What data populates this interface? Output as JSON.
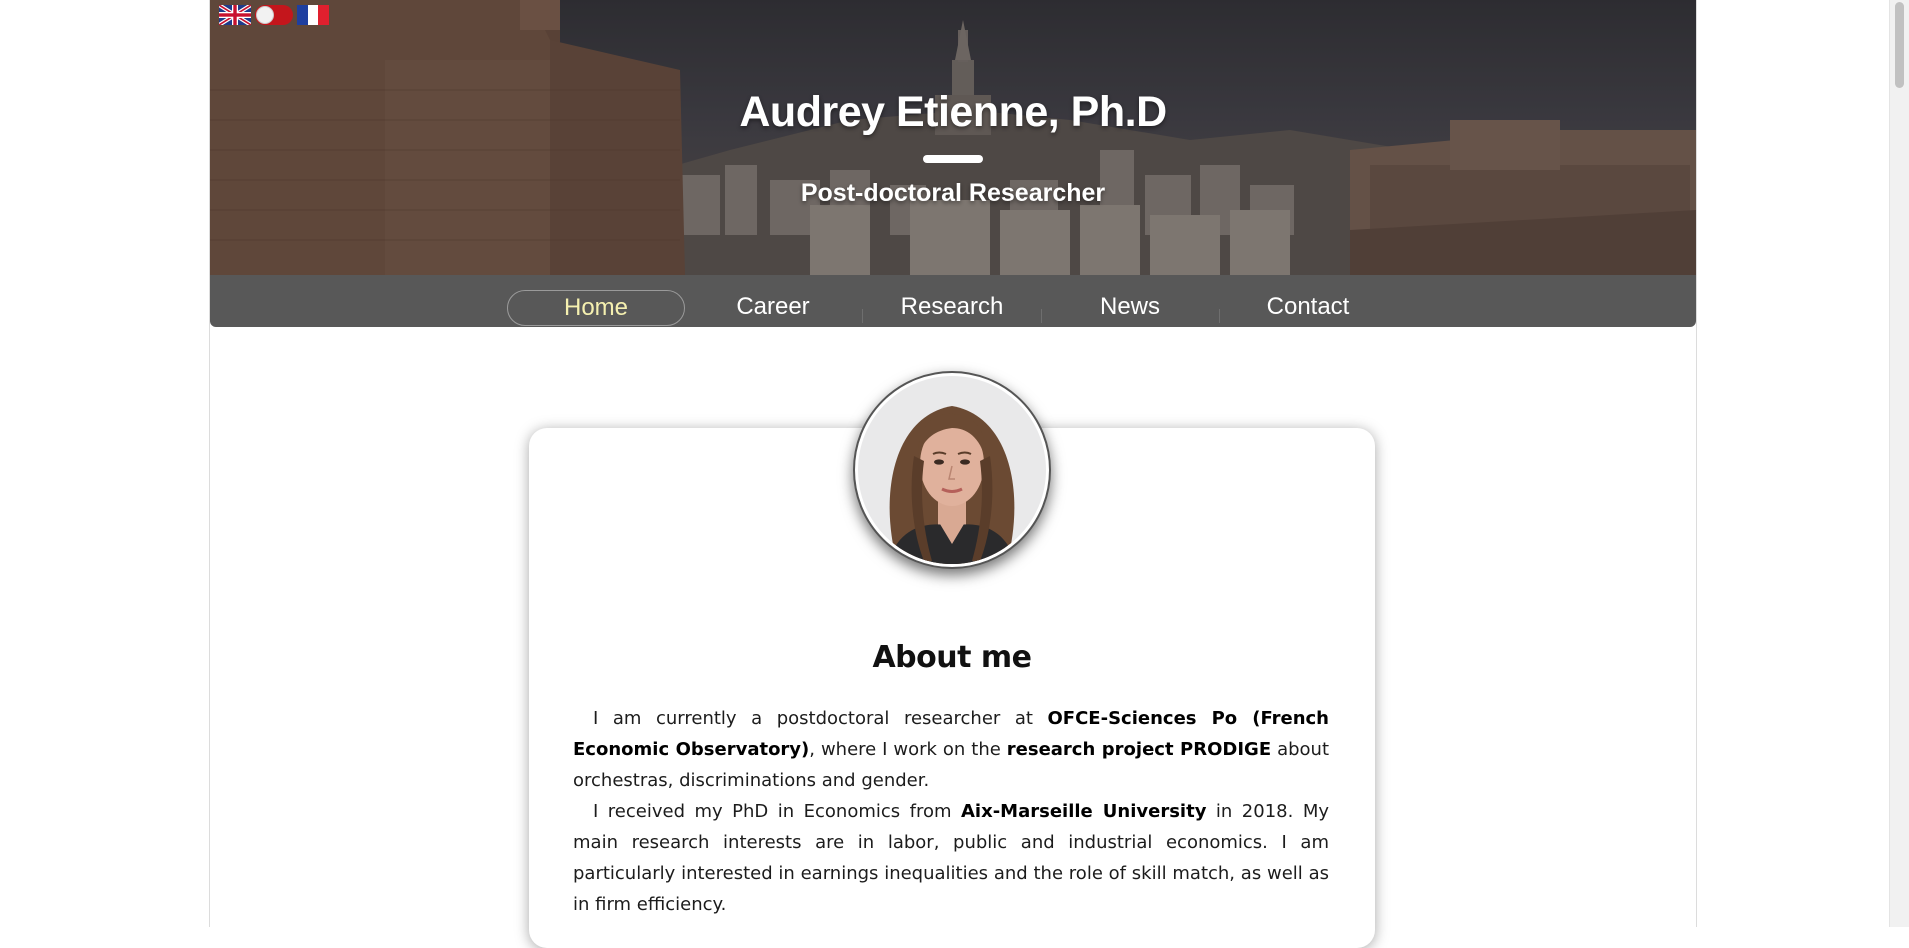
{
  "header": {
    "name": "Audrey Etienne, Ph.D",
    "subtitle": "Post-doctoral Researcher",
    "languages": [
      {
        "icon": "uk-flag-icon",
        "label": "English"
      },
      {
        "icon": "language-toggle-icon",
        "label": "Toggle"
      },
      {
        "icon": "france-flag-icon",
        "label": "French"
      }
    ]
  },
  "nav": {
    "items": [
      "Home",
      "Career",
      "Research",
      "News",
      "Contact"
    ],
    "active": "Home",
    "active_color": "#f5f0b0"
  },
  "about": {
    "title": "About me",
    "p1": {
      "t1": "I am currently a postdoctoral researcher at ",
      "b1": "OFCE-Sciences Po (French Economic Observatory)",
      "t2": ", where I work on the ",
      "b2": "research project PRODIGE",
      "t3": " about orchestras, discriminations and gender."
    },
    "p2": {
      "t1": "I received my PhD in Economics from ",
      "b1": "Aix-Marseille University",
      "t2": " in 2018. My main research interests are in labor, public and industrial economics. I am particularly interested in earnings inequalities and the role of skill match, as well as in firm efficiency."
    }
  },
  "colors": {
    "nav_bg": "#585858",
    "text": "#1c1c1c"
  }
}
